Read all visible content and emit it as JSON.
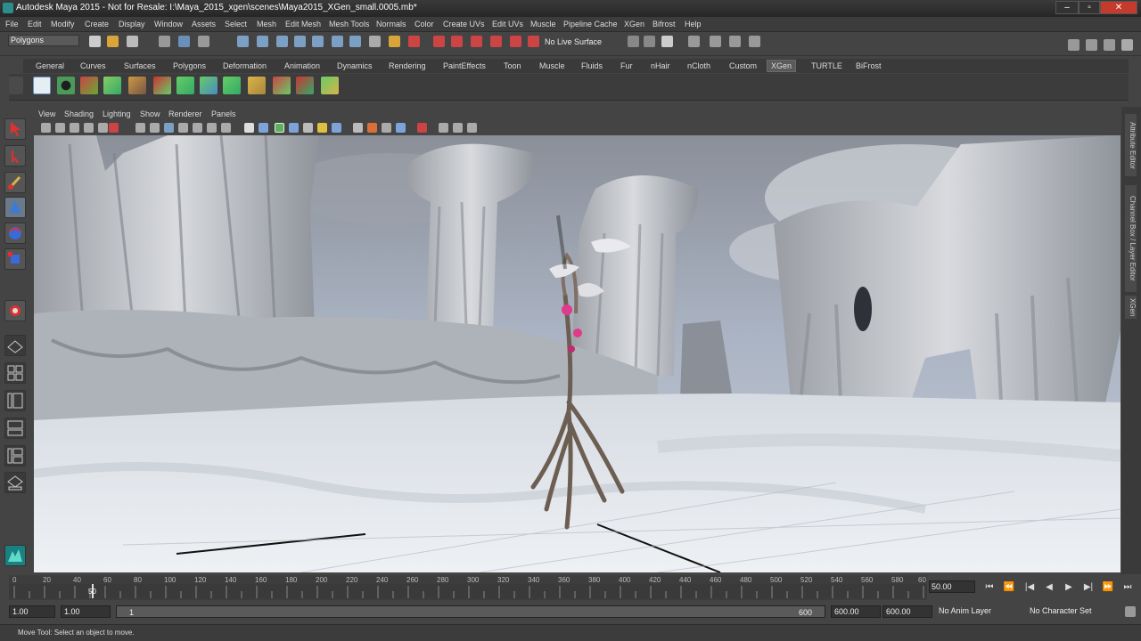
{
  "window": {
    "title": "Autodesk Maya 2015 - Not for Resale: I:\\Maya_2015_xgen\\scenes\\Maya2015_XGen_small.0005.mb*",
    "controls": [
      "–",
      "▫",
      "✕"
    ]
  },
  "menubar": [
    "File",
    "Edit",
    "Modify",
    "Create",
    "Display",
    "Window",
    "Assets",
    "Select",
    "Mesh",
    "Edit Mesh",
    "Mesh Tools",
    "Normals",
    "Color",
    "Create UVs",
    "Edit UVs",
    "Muscle",
    "Pipeline Cache",
    "XGen",
    "Bifrost",
    "Help"
  ],
  "statusline": {
    "mode": "Polygons",
    "live_surface": "No Live Surface"
  },
  "shelf_tabs": [
    "General",
    "Curves",
    "Surfaces",
    "Polygons",
    "Deformation",
    "Animation",
    "Dynamics",
    "Rendering",
    "PaintEffects",
    "Toon",
    "Muscle",
    "Fluids",
    "Fur",
    "nHair",
    "nCloth",
    "Custom",
    "XGen",
    "TURTLE",
    "BiFrost"
  ],
  "shelf_active": "XGen",
  "viewport_menu": [
    "View",
    "Shading",
    "Lighting",
    "Show",
    "Renderer",
    "Panels"
  ],
  "right_tabs": [
    "Attribute Editor",
    "Channel Box / Layer Editor",
    "XGen"
  ],
  "timeline": {
    "ticks": [
      "0",
      "20",
      "40",
      "60",
      "80",
      "100",
      "120",
      "140",
      "160",
      "180",
      "200",
      "220",
      "240",
      "260",
      "280",
      "300",
      "320",
      "340",
      "360",
      "380",
      "400",
      "420",
      "440",
      "460",
      "480",
      "500",
      "520",
      "540",
      "560",
      "580",
      "60"
    ],
    "current_marker": "50",
    "current_frame": "50.00"
  },
  "playback": [
    "⏮",
    "⏪",
    "|◀",
    "◀",
    "▶",
    "▶|",
    "⏩",
    "⏭"
  ],
  "range": {
    "start": "1.00",
    "start_inner": "1.00",
    "slider_start": "1",
    "slider_end": "600",
    "end_inner": "600.00",
    "end": "600.00",
    "anim_layer": "No Anim Layer",
    "char_set": "No Character Set"
  },
  "helpline": "Move Tool: Select an object to move."
}
